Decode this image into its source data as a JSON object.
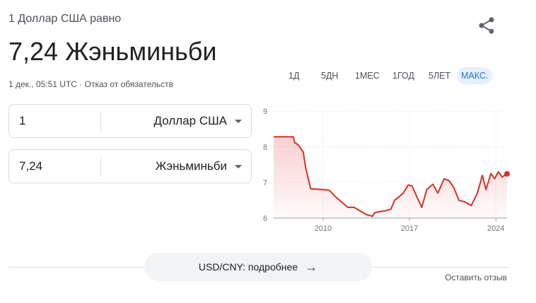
{
  "header": {
    "subtitle": "1 Доллар США равно",
    "rate_text": "7,24 Жэньминьби",
    "meta": "1 дек., 05:51 UTC · Отказ от обязательств"
  },
  "icons": {
    "share": "share-icon",
    "dropdown": "triangle-down-icon",
    "arrow": "arrow-right-icon"
  },
  "converter": {
    "from": {
      "value": "1",
      "currency": "Доллар США"
    },
    "to": {
      "value": "7,24",
      "currency": "Жэньминьби"
    }
  },
  "ranges": [
    {
      "label": "1Д",
      "active": false
    },
    {
      "label": "5ДН",
      "active": false
    },
    {
      "label": "1МЕС",
      "active": false
    },
    {
      "label": "1ГОД",
      "active": false
    },
    {
      "label": "5ЛЕТ",
      "active": false
    },
    {
      "label": "МАКС.",
      "active": true
    }
  ],
  "chart_data": {
    "type": "line",
    "title": "",
    "xlabel": "",
    "ylabel": "",
    "ylim": [
      6,
      9
    ],
    "xlim": [
      2006.0,
      2024.9
    ],
    "y_ticks": [
      "9",
      "8",
      "7",
      "6"
    ],
    "x_ticks": [
      "2010",
      "2017",
      "2024"
    ],
    "grid": true,
    "line_color": "#d93025",
    "series": [
      {
        "x": [
          2006.0,
          2007.6,
          2007.7,
          2008.0,
          2008.4,
          2008.6,
          2009.0,
          2010.0,
          2010.5,
          2011.0,
          2011.5,
          2012.0,
          2012.5,
          2013.0,
          2013.5,
          2014.0,
          2014.2,
          2014.6,
          2015.0,
          2015.5,
          2015.8,
          2016.0,
          2016.5,
          2016.9,
          2017.2,
          2017.6,
          2018.0,
          2018.4,
          2018.9,
          2019.3,
          2019.8,
          2020.2,
          2020.6,
          2021.0,
          2021.5,
          2022.0,
          2022.5,
          2022.9,
          2023.2,
          2023.6,
          2023.9,
          2024.2,
          2024.5,
          2024.9
        ],
        "y": [
          8.28,
          8.28,
          8.12,
          8.05,
          7.85,
          7.4,
          6.82,
          6.8,
          6.78,
          6.6,
          6.45,
          6.3,
          6.3,
          6.2,
          6.1,
          6.05,
          6.15,
          6.18,
          6.2,
          6.25,
          6.5,
          6.55,
          6.7,
          6.93,
          6.9,
          6.6,
          6.3,
          6.8,
          6.95,
          6.7,
          7.1,
          7.05,
          6.85,
          6.5,
          6.45,
          6.35,
          6.7,
          7.2,
          6.8,
          7.25,
          7.1,
          7.3,
          7.15,
          7.24
        ]
      }
    ],
    "end_value": 7.24
  },
  "footer": {
    "details_label": "USD/CNY: подробнее",
    "feedback_label": "Оставить отзыв"
  }
}
